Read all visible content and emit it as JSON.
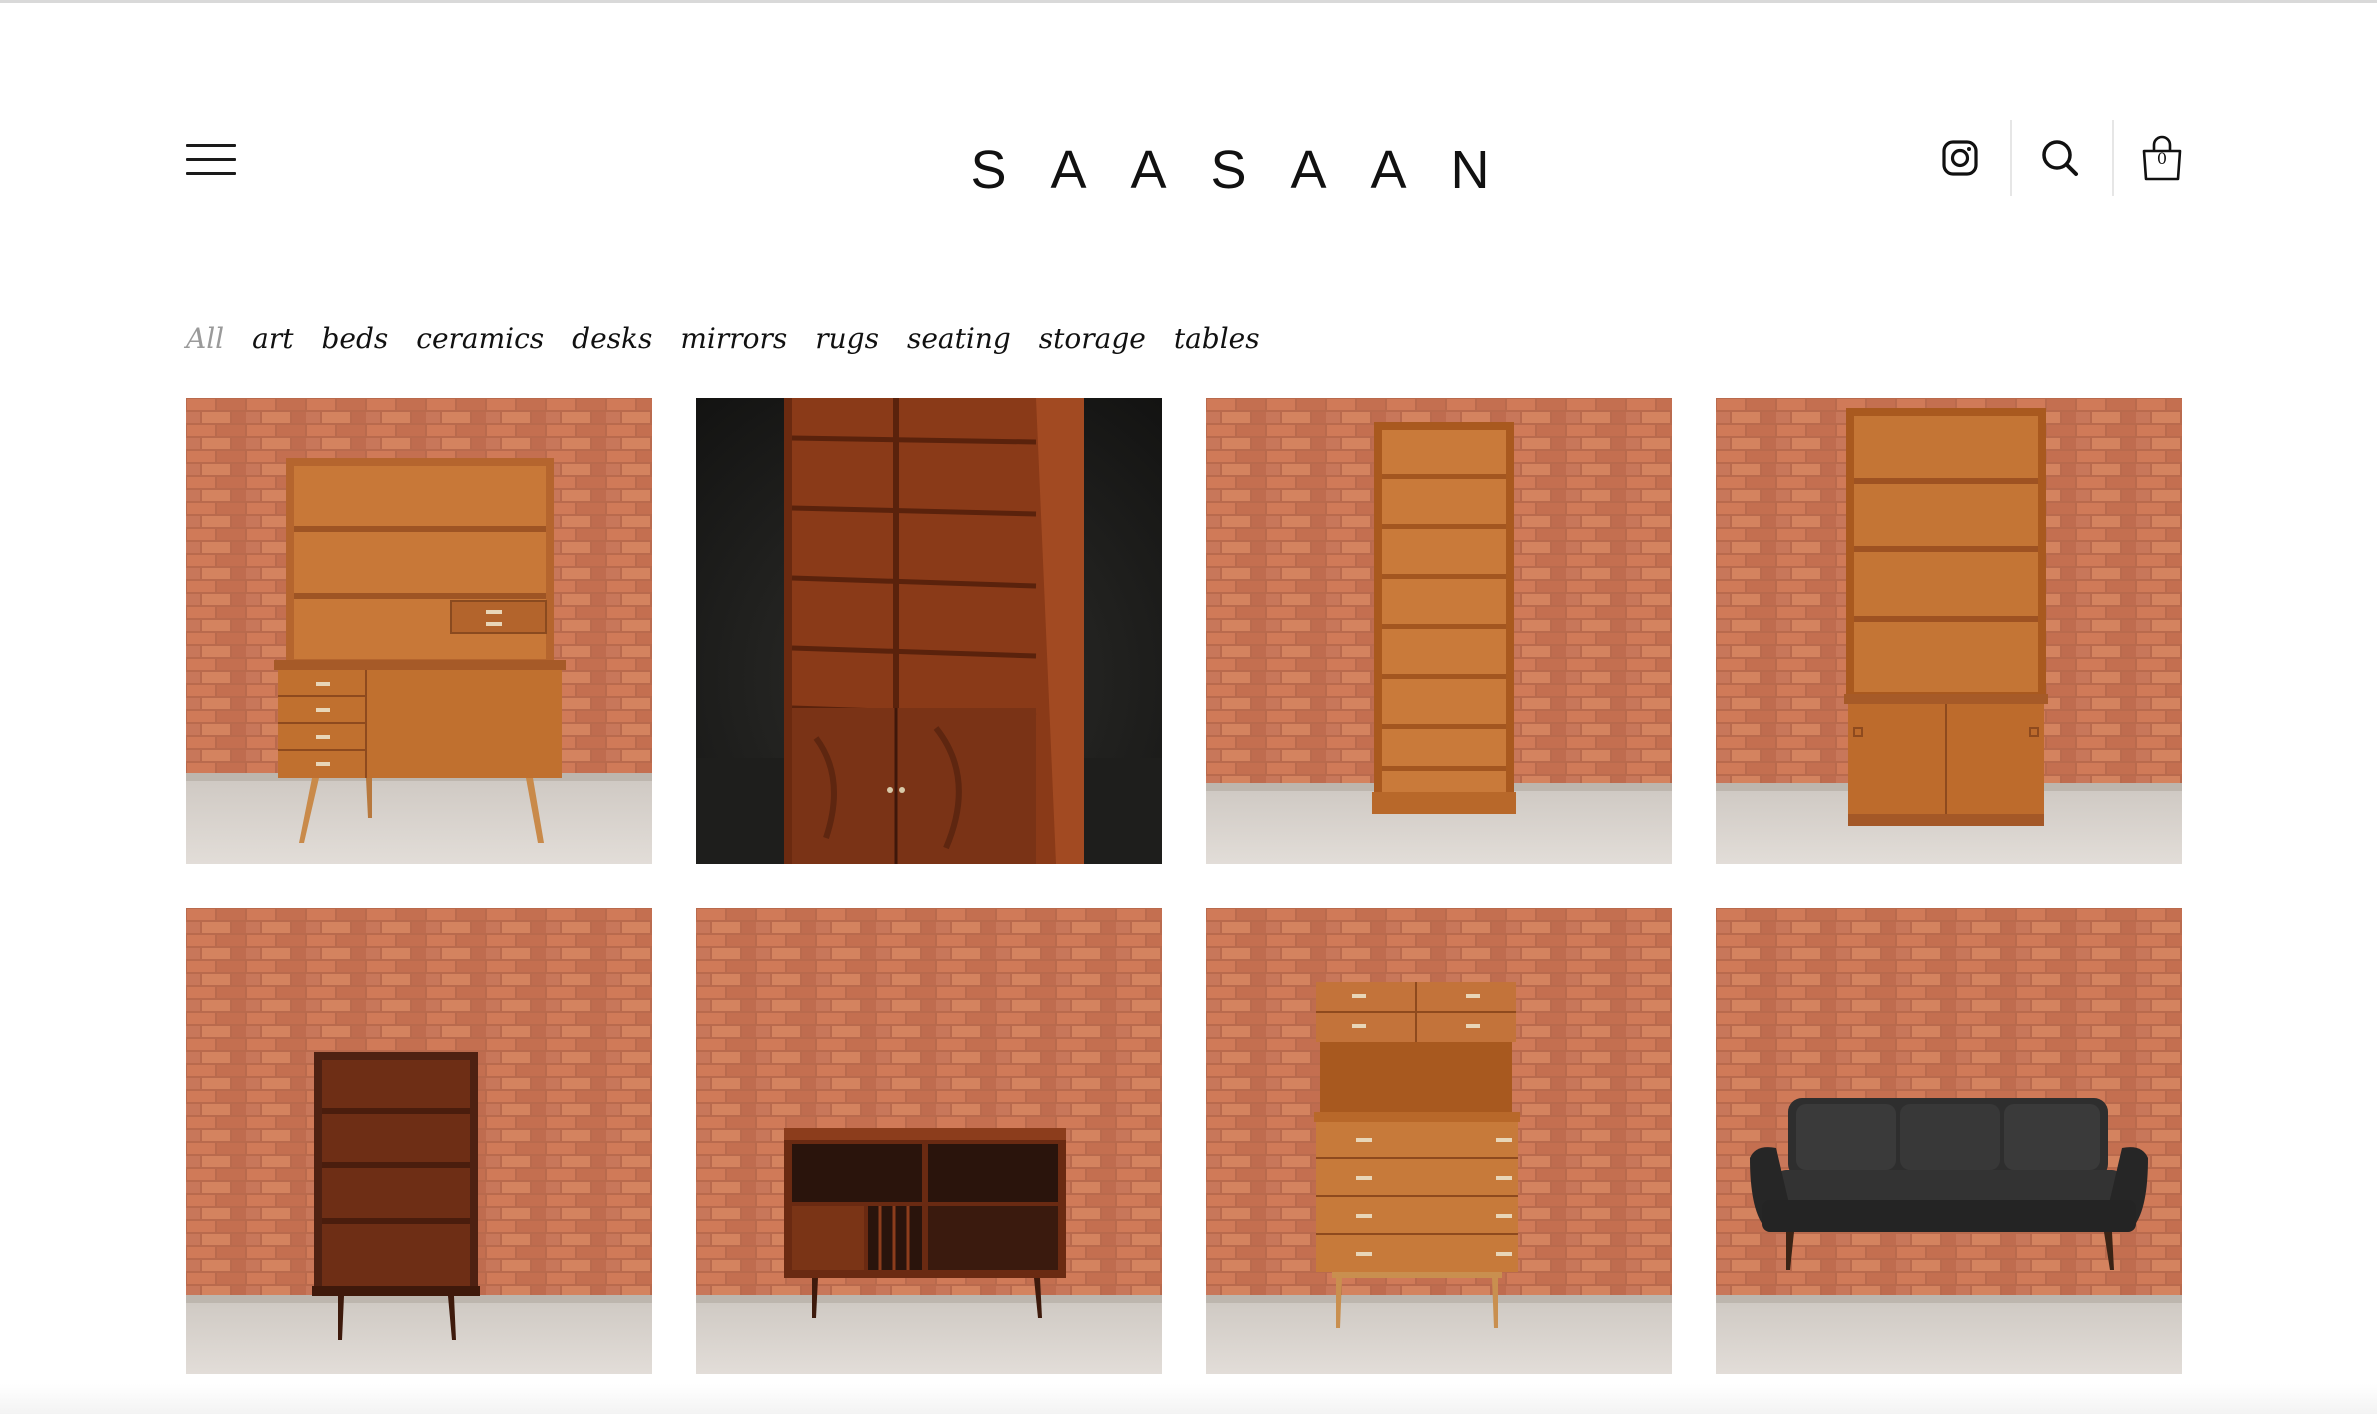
{
  "brand": {
    "name": "SAASAAN"
  },
  "header": {
    "menu_icon": "hamburger-menu-icon",
    "icons": [
      "instagram-icon",
      "search-icon",
      "shopping-bag-icon"
    ],
    "cart_count": "0"
  },
  "filters": {
    "items": [
      "All",
      "art",
      "beds",
      "ceramics",
      "desks",
      "mirrors",
      "rugs",
      "seating",
      "storage",
      "tables"
    ],
    "active": "All"
  },
  "products": [
    {
      "image": "teak secretary bookcase with drawers on tapered legs",
      "background": "brick wall"
    },
    {
      "image": "rosewood tall bookcase with lower cabinet",
      "background": "dark studio"
    },
    {
      "image": "tall narrow teak bookshelf",
      "background": "brick wall"
    },
    {
      "image": "teak bookcase with sliding door cabinet base",
      "background": "brick wall"
    },
    {
      "image": "rosewood bookcase on tapered legs",
      "background": "brick wall"
    },
    {
      "image": "rosewood record cabinet sideboard",
      "background": "brick wall"
    },
    {
      "image": "teak secretary desk with drawers",
      "background": "brick wall"
    },
    {
      "image": "black leather three seat sofa",
      "background": "brick wall"
    }
  ],
  "colors": {
    "text": "#111111",
    "filter_active": "#9a9a9a",
    "brick": "#c8704e",
    "floor": "#d9d3cc",
    "teak": "#b8652a",
    "rosewood": "#7a3214",
    "leather": "#2b2b2b"
  }
}
